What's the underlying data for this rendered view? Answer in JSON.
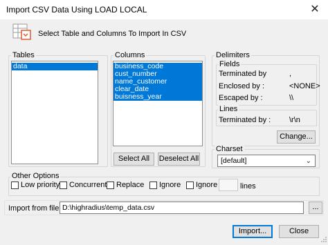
{
  "window": {
    "title": "Import CSV Data Using LOAD LOCAL",
    "close_glyph": "✕"
  },
  "header": {
    "text": "Select Table and Columns To Import In CSV",
    "icon": "table-import-icon"
  },
  "tables": {
    "label": "Tables",
    "items": [
      {
        "label": "data",
        "selected": true
      }
    ]
  },
  "columns": {
    "label": "Columns",
    "items": [
      {
        "label": "business_code",
        "selected": true
      },
      {
        "label": "cust_number",
        "selected": true
      },
      {
        "label": "name_customer",
        "selected": true
      },
      {
        "label": "clear_date",
        "selected": true
      },
      {
        "label": "buisness_year",
        "selected": true
      }
    ],
    "select_all_label": "Select All",
    "deselect_all_label": "Deselect All"
  },
  "delimiters": {
    "label": "Delimiters",
    "fields_label": "Fields",
    "terminated_by_label": "Terminated by",
    "terminated_by_value": ",",
    "enclosed_by_label": "Enclosed by :",
    "enclosed_by_value": "<NONE>",
    "escaped_by_label": "Escaped by :",
    "escaped_by_value": "\\\\",
    "lines_label": "Lines",
    "lines_terminated_label": "Terminated by :",
    "lines_terminated_value": "\\r\\n",
    "change_label": "Change..."
  },
  "charset": {
    "label": "Charset",
    "value": "[default]"
  },
  "other_options": {
    "label": "Other Options",
    "low_priority": "Low priority",
    "concurrent": "Concurrent",
    "replace": "Replace",
    "ignore": "Ignore",
    "ignore_lines_prefix": "Ignore",
    "ignore_lines_suffix": "lines",
    "ignore_lines_value": ""
  },
  "import_file": {
    "label": "Import from file",
    "path": "D:\\highradius\\temp_data.csv",
    "browse_label": "..."
  },
  "actions": {
    "import_label": "Import...",
    "close_label": "Close"
  }
}
